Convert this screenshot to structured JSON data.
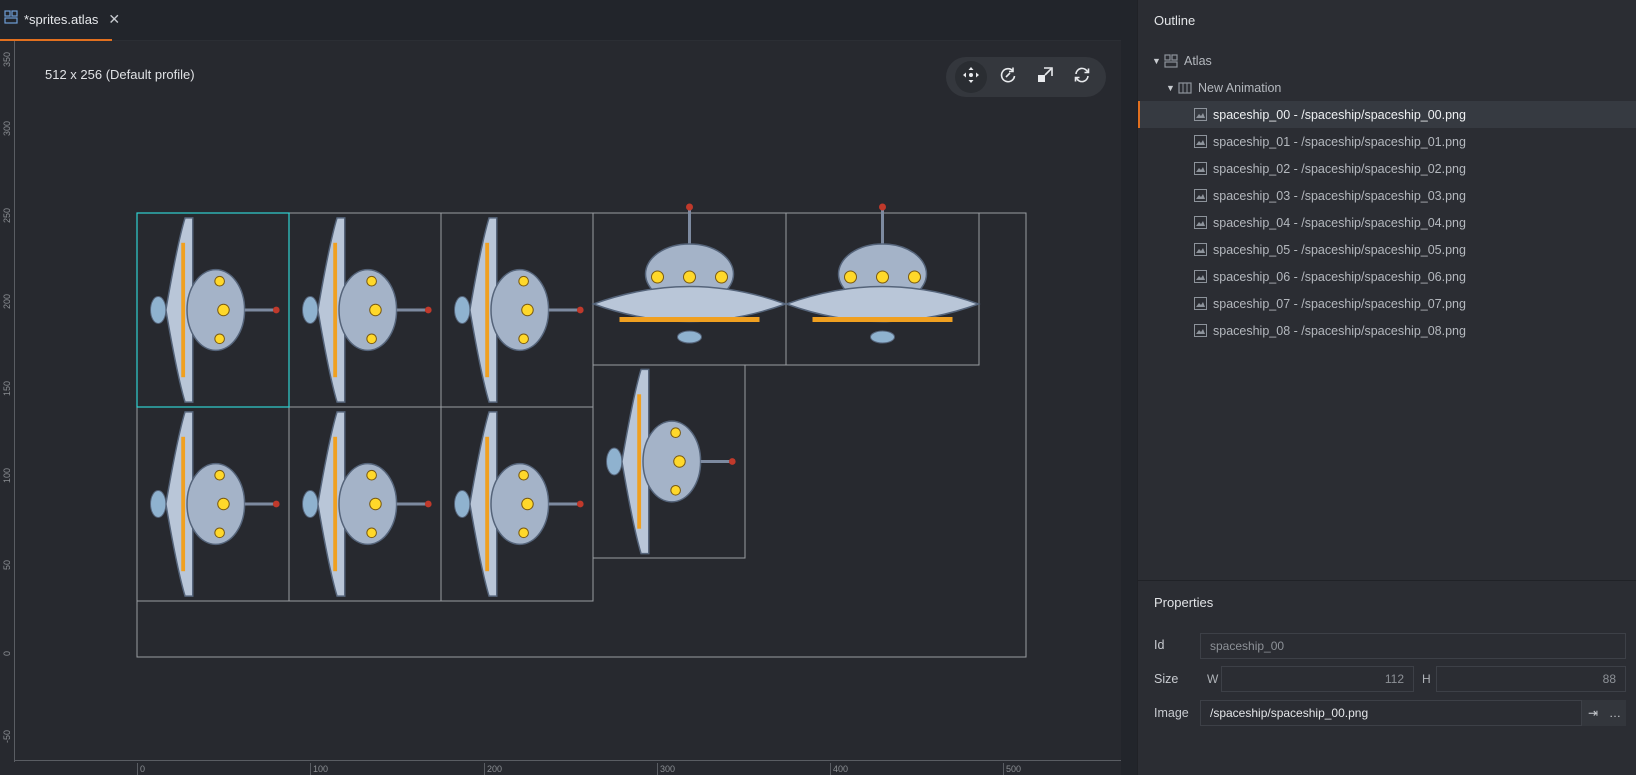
{
  "tab": {
    "label": "*sprites.atlas",
    "close": "✕"
  },
  "scene": {
    "profile_label": "512 x 256 (Default profile)",
    "ruler_v": [
      "350",
      "300",
      "250",
      "200",
      "150",
      "100",
      "50",
      "0",
      "-50"
    ],
    "ruler_h": [
      "0",
      "100",
      "200",
      "300",
      "400",
      "500"
    ],
    "tools": [
      "move-icon",
      "rotate-icon",
      "scale-icon",
      "cycle-icon"
    ]
  },
  "outline": {
    "title": "Outline",
    "root": "Atlas",
    "animation": "New Animation",
    "items": [
      "spaceship_00 - /spaceship/spaceship_00.png",
      "spaceship_01 - /spaceship/spaceship_01.png",
      "spaceship_02 - /spaceship/spaceship_02.png",
      "spaceship_03 - /spaceship/spaceship_03.png",
      "spaceship_04 - /spaceship/spaceship_04.png",
      "spaceship_05 - /spaceship/spaceship_05.png",
      "spaceship_06 - /spaceship/spaceship_06.png",
      "spaceship_07 - /spaceship/spaceship_07.png",
      "spaceship_08 - /spaceship/spaceship_08.png"
    ]
  },
  "properties": {
    "title": "Properties",
    "id_label": "Id",
    "id_placeholder": "spaceship_00",
    "size_label": "Size",
    "w_label": "W",
    "w_value": "112",
    "h_label": "H",
    "h_value": "88",
    "image_label": "Image",
    "image_value": "/spaceship/spaceship_00.png",
    "image_btn_1": "⇥",
    "image_btn_2": "…"
  },
  "colors": {
    "accent": "#e2701f",
    "selection": "#2fd2d2",
    "grid": "#9a9da2"
  }
}
